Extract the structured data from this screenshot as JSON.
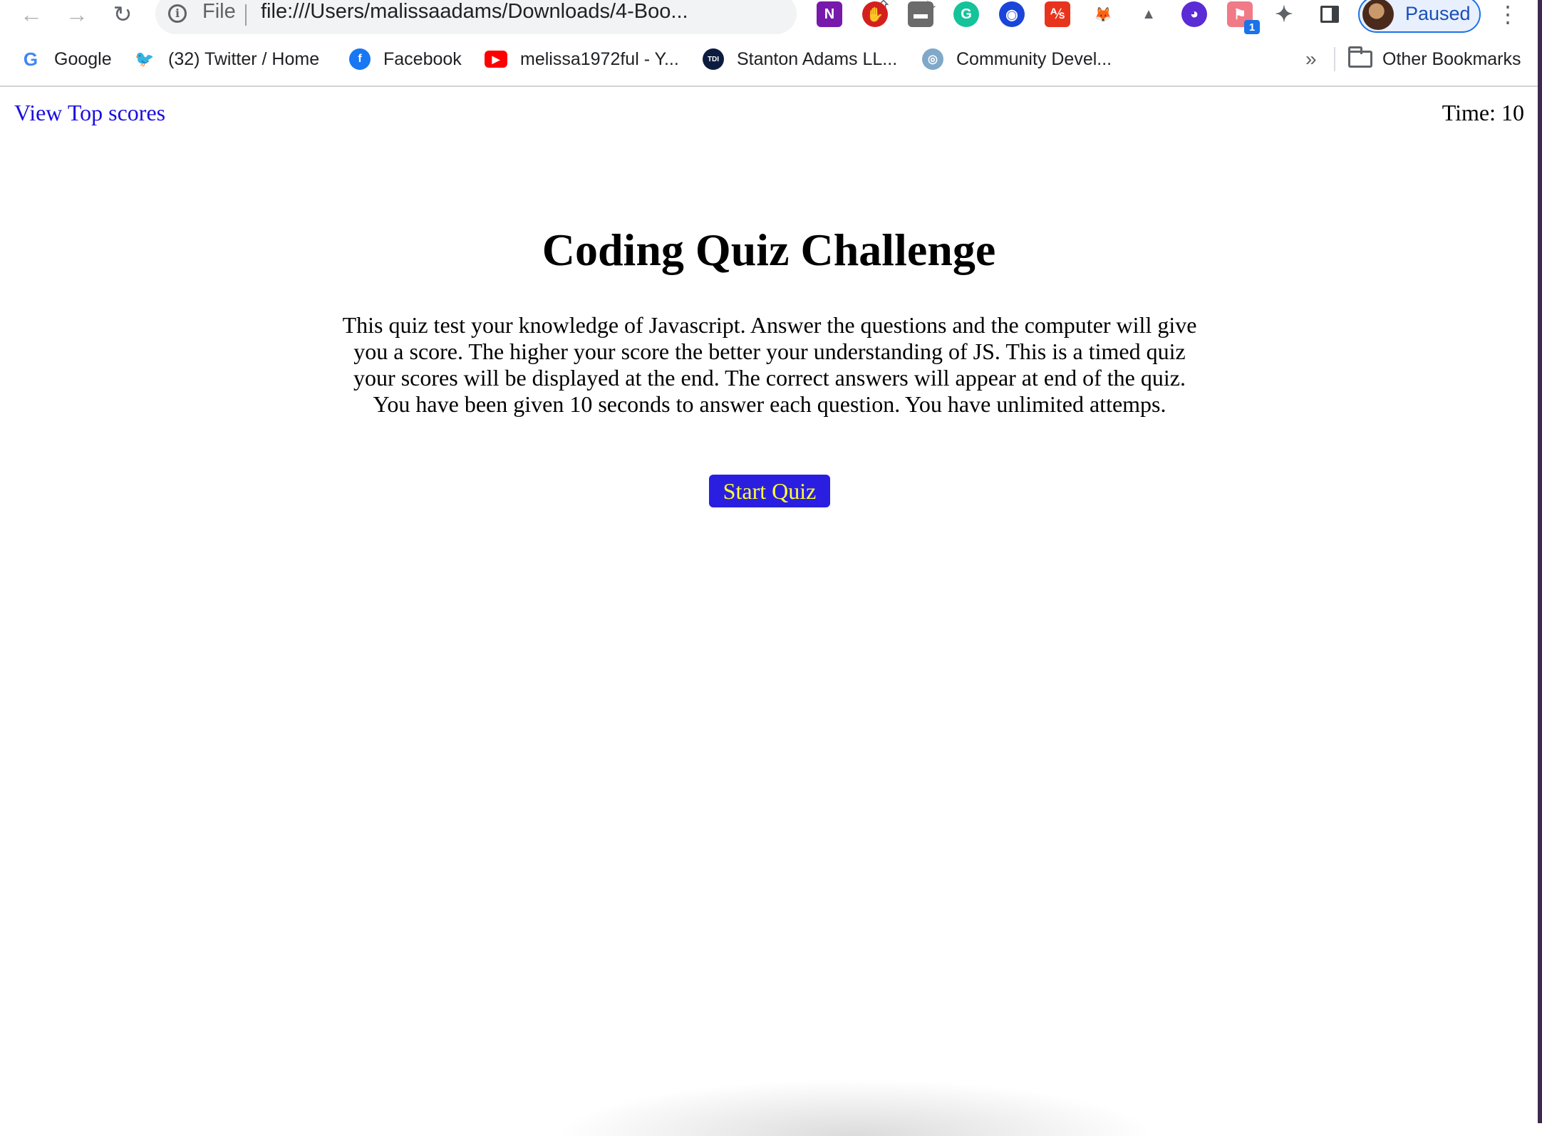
{
  "browser": {
    "omnibox": {
      "scheme_label": "File",
      "url": "file:///Users/malissaadams/Downloads/4-Boo..."
    },
    "extensions": [
      {
        "name": "onenote-icon",
        "glyph": "N",
        "color": "#7719aa"
      },
      {
        "name": "adblock-icon",
        "glyph": "✋",
        "color": "#d41f1f"
      },
      {
        "name": "video-ext-icon",
        "glyph": "▬",
        "color": "#6b6b6b"
      },
      {
        "name": "grammarly-icon",
        "glyph": "G",
        "color": "#15c39a"
      },
      {
        "name": "target-ext-icon",
        "glyph": "◉",
        "color": "#1a45d8"
      },
      {
        "name": "pdf-ext-icon",
        "glyph": "⅍",
        "color": "#e8341c"
      },
      {
        "name": "metamask-icon",
        "glyph": "🦊",
        "color": "#ffffff"
      },
      {
        "name": "triangle-ext-icon",
        "glyph": "▲",
        "color": "#ffffff"
      },
      {
        "name": "ghost-ext-icon",
        "glyph": "◕",
        "color": "#5b2bd6"
      },
      {
        "name": "flag-ext-icon",
        "glyph": "⚑",
        "color": "#f07a86",
        "badge": "1"
      }
    ],
    "profile": {
      "label": "Paused"
    },
    "bookmarks": [
      {
        "name": "bookmark-google",
        "label": "Google",
        "icon_glyph": "G",
        "icon_color": "#4285f4"
      },
      {
        "name": "bookmark-twitter",
        "label": "(32) Twitter / Home",
        "icon_glyph": "🐦",
        "icon_color": "#1da1f2"
      },
      {
        "name": "bookmark-facebook",
        "label": "Facebook",
        "icon_glyph": "f",
        "icon_color": "#1877f2"
      },
      {
        "name": "bookmark-youtube",
        "label": "melissa1972ful - Y...",
        "icon_glyph": "▶",
        "icon_color": "#ff0000"
      },
      {
        "name": "bookmark-stanton",
        "label": "Stanton Adams LL...",
        "icon_glyph": "TDI",
        "icon_color": "#0d1b3e"
      },
      {
        "name": "bookmark-community",
        "label": "Community Devel...",
        "icon_glyph": "◎",
        "icon_color": "#7fa8c9"
      }
    ],
    "bookmarks_more": "»",
    "other_bookmarks": "Other Bookmarks"
  },
  "page": {
    "top_scores_link": "View Top scores",
    "timer": "Time: 10",
    "title": "Coding Quiz Challenge",
    "intro": "This quiz test your knowledge of Javascript. Answer the questions and the computer will give you a score. The higher your score the better your understanding of JS. This is a timed quiz your scores will be displayed at the end. The correct answers will appear at end of the quiz. You have been given 10 seconds to answer each question. You have unlimited attemps.",
    "start_button": "Start Quiz",
    "colors": {
      "link": "#1a0dde",
      "button_bg": "#2a1fe0",
      "button_text": "#ffff33"
    }
  }
}
